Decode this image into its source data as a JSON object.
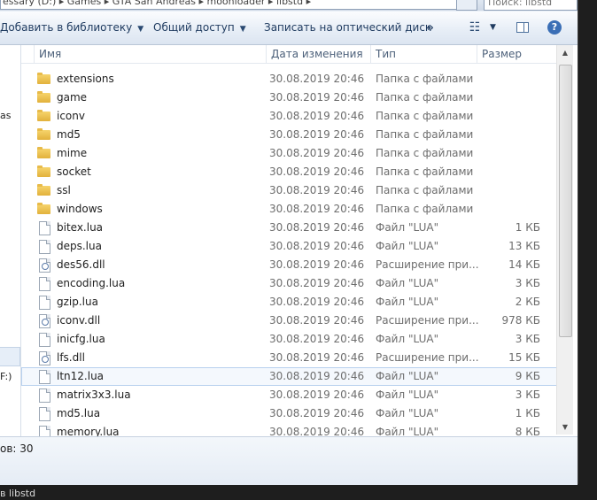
{
  "address": {
    "path": "essary (D:) ▸ Games ▸ GTA San Andreas ▸ moonloader ▸ libstd ▸",
    "search_placeholder": "Поиск: libstd"
  },
  "toolbar": {
    "add_to_library": "Добавить в библиотеку",
    "share": "Общий доступ",
    "burn": "Записать на оптический диск",
    "more": "»",
    "help": "?"
  },
  "nav": {
    "frag1": "as",
    "frag2": "F:)"
  },
  "columns": {
    "name": "Имя",
    "date": "Дата изменения",
    "type": "Тип",
    "size": "Размер"
  },
  "files": [
    {
      "name": "extensions",
      "date": "30.08.2019 20:46",
      "type": "Папка с файлами",
      "size": "",
      "icon": "folder-icon"
    },
    {
      "name": "game",
      "date": "30.08.2019 20:46",
      "type": "Папка с файлами",
      "size": "",
      "icon": "folder-icon"
    },
    {
      "name": "iconv",
      "date": "30.08.2019 20:46",
      "type": "Папка с файлами",
      "size": "",
      "icon": "folder-icon"
    },
    {
      "name": "md5",
      "date": "30.08.2019 20:46",
      "type": "Папка с файлами",
      "size": "",
      "icon": "folder-icon"
    },
    {
      "name": "mime",
      "date": "30.08.2019 20:46",
      "type": "Папка с файлами",
      "size": "",
      "icon": "folder-icon"
    },
    {
      "name": "socket",
      "date": "30.08.2019 20:46",
      "type": "Папка с файлами",
      "size": "",
      "icon": "folder-icon"
    },
    {
      "name": "ssl",
      "date": "30.08.2019 20:46",
      "type": "Папка с файлами",
      "size": "",
      "icon": "folder-icon"
    },
    {
      "name": "windows",
      "date": "30.08.2019 20:46",
      "type": "Папка с файлами",
      "size": "",
      "icon": "folder-icon"
    },
    {
      "name": "bitex.lua",
      "date": "30.08.2019 20:46",
      "type": "Файл \"LUA\"",
      "size": "1 КБ",
      "icon": "file-icon"
    },
    {
      "name": "deps.lua",
      "date": "30.08.2019 20:46",
      "type": "Файл \"LUA\"",
      "size": "13 КБ",
      "icon": "file-icon"
    },
    {
      "name": "des56.dll",
      "date": "30.08.2019 20:46",
      "type": "Расширение при...",
      "size": "14 КБ",
      "icon": "dll-icon"
    },
    {
      "name": "encoding.lua",
      "date": "30.08.2019 20:46",
      "type": "Файл \"LUA\"",
      "size": "3 КБ",
      "icon": "file-icon"
    },
    {
      "name": "gzip.lua",
      "date": "30.08.2019 20:46",
      "type": "Файл \"LUA\"",
      "size": "2 КБ",
      "icon": "file-icon"
    },
    {
      "name": "iconv.dll",
      "date": "30.08.2019 20:46",
      "type": "Расширение при...",
      "size": "978 КБ",
      "icon": "dll-icon"
    },
    {
      "name": "inicfg.lua",
      "date": "30.08.2019 20:46",
      "type": "Файл \"LUA\"",
      "size": "3 КБ",
      "icon": "file-icon"
    },
    {
      "name": "lfs.dll",
      "date": "30.08.2019 20:46",
      "type": "Расширение при...",
      "size": "15 КБ",
      "icon": "dll-icon"
    },
    {
      "name": "ltn12.lua",
      "date": "30.08.2019 20:46",
      "type": "Файл \"LUA\"",
      "size": "9 КБ",
      "icon": "file-icon"
    },
    {
      "name": "matrix3x3.lua",
      "date": "30.08.2019 20:46",
      "type": "Файл \"LUA\"",
      "size": "3 КБ",
      "icon": "file-icon"
    },
    {
      "name": "md5.lua",
      "date": "30.08.2019 20:46",
      "type": "Файл \"LUA\"",
      "size": "1 КБ",
      "icon": "file-icon"
    },
    {
      "name": "memory.lua",
      "date": "30.08.2019 20:46",
      "type": "Файл \"LUA\"",
      "size": "8 КБ",
      "icon": "file-icon"
    }
  ],
  "status": {
    "count_text": "ов: 30"
  },
  "taskbar": {
    "label": "в libstd"
  }
}
